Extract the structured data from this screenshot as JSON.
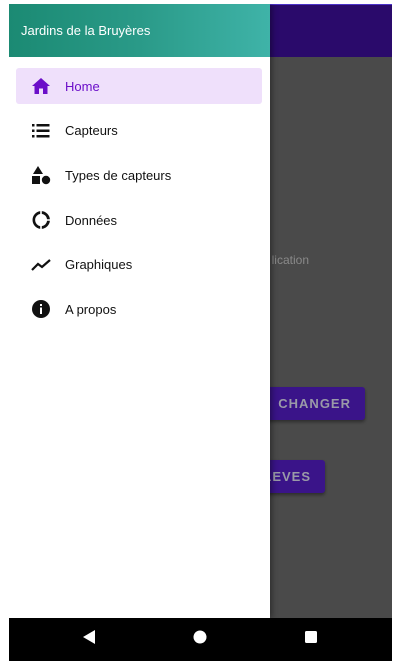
{
  "app": {
    "title": "Jardins de la Bruyères"
  },
  "drawer": {
    "items": [
      {
        "label": "Home",
        "icon": "home-icon",
        "active": true
      },
      {
        "label": "Capteurs",
        "icon": "list-icon",
        "active": false
      },
      {
        "label": "Types de capteurs",
        "icon": "shapes-icon",
        "active": false
      },
      {
        "label": "Données",
        "icon": "donut-chart-icon",
        "active": false
      },
      {
        "label": "Graphiques",
        "icon": "line-chart-icon",
        "active": false
      },
      {
        "label": "A propos",
        "icon": "info-icon",
        "active": false
      }
    ]
  },
  "background": {
    "text_fragment": "lication",
    "button_change": "CHANGER",
    "button_releves": "LEVES"
  },
  "colors": {
    "toolbar": "#2a0a6b",
    "drawer_header_start": "#1b8a73",
    "drawer_header_end": "#3fb3a8",
    "active_item_bg": "#efe0fb",
    "active_item_text": "#6b0fc9"
  },
  "navigation_bar": {
    "back": "back-icon",
    "home": "home-circle-icon",
    "recents": "recents-icon"
  }
}
